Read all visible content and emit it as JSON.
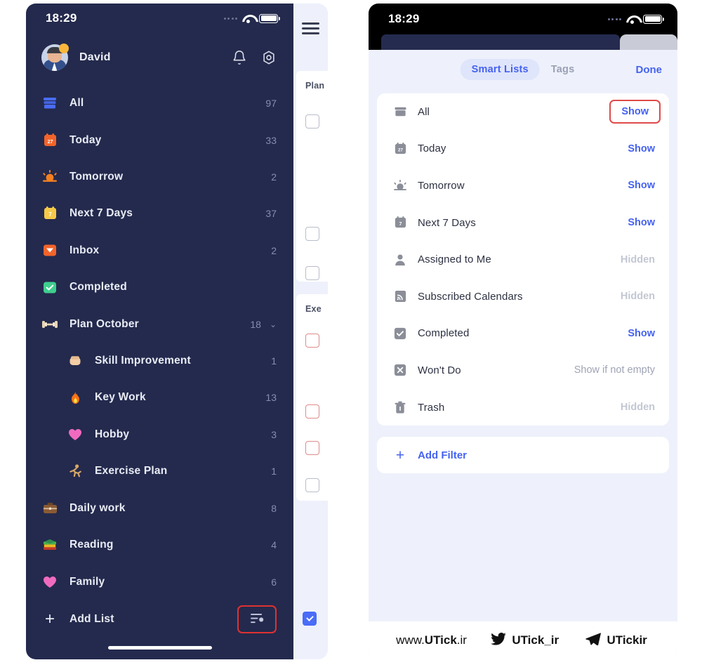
{
  "left_phone": {
    "status_bar": {
      "time": "18:29",
      "wifi_icon": "wifi-icon",
      "battery_icon": "battery-icon"
    },
    "profile": {
      "name": "David",
      "avatar_icon": "avatar",
      "bell_icon": "bell-icon",
      "settings_icon": "gear-icon"
    },
    "nav_items": [
      {
        "label": "All",
        "count": "97",
        "icon": "archive-box-icon",
        "color": "#4a6cf7",
        "indent": false,
        "chevron": ""
      },
      {
        "label": "Today",
        "count": "33",
        "icon": "calendar-27-icon",
        "color": "#f2642a",
        "indent": false,
        "chevron": ""
      },
      {
        "label": "Tomorrow",
        "count": "2",
        "icon": "sunrise-icon",
        "color": "#f58020",
        "indent": false,
        "chevron": ""
      },
      {
        "label": "Next 7 Days",
        "count": "37",
        "icon": "calendar-week-icon",
        "color": "#f7c948",
        "indent": false,
        "chevron": ""
      },
      {
        "label": "Inbox",
        "count": "2",
        "icon": "inbox-icon",
        "color": "#f2642a",
        "indent": false,
        "chevron": ""
      },
      {
        "label": "Completed",
        "count": "",
        "icon": "check-square-icon",
        "color": "#3ecf8e",
        "indent": false,
        "chevron": ""
      },
      {
        "label": "Plan October",
        "count": "18",
        "icon": "dumbbell-emoji",
        "color": "#e8d5b5",
        "indent": false,
        "chevron": "⌄"
      },
      {
        "label": "Skill Improvement",
        "count": "1",
        "icon": "fist-emoji",
        "color": "#f3cda6",
        "indent": true,
        "chevron": ""
      },
      {
        "label": "Key Work",
        "count": "13",
        "icon": "fire-emoji",
        "color": "#f97316",
        "indent": true,
        "chevron": ""
      },
      {
        "label": "Hobby",
        "count": "3",
        "icon": "pink-heart-emoji",
        "color": "#f06bc0",
        "indent": true,
        "chevron": ""
      },
      {
        "label": "Exercise Plan",
        "count": "1",
        "icon": "running-emoji",
        "color": "#d8a86a",
        "indent": true,
        "chevron": ""
      },
      {
        "label": "Daily work",
        "count": "8",
        "icon": "briefcase-emoji",
        "color": "#8a5a34",
        "indent": false,
        "chevron": ""
      },
      {
        "label": "Reading",
        "count": "4",
        "icon": "books-emoji",
        "color": "#4cae4c",
        "indent": false,
        "chevron": ""
      },
      {
        "label": "Family",
        "count": "6",
        "icon": "pink-heart-emoji",
        "color": "#f06bc0",
        "indent": false,
        "chevron": ""
      }
    ],
    "add_list": {
      "label": "Add List",
      "plus_icon": "plus-icon",
      "sort_icon": "sort-settings-icon",
      "sort_highlighted": true
    },
    "peek_panel": {
      "menu_icon": "hamburger-menu-icon",
      "section_1": "Plan",
      "section_2": "Exe"
    }
  },
  "right_phone": {
    "status_bar": {
      "time": "18:29",
      "wifi_icon": "wifi-icon",
      "battery_icon": "battery-icon"
    },
    "tabs": {
      "smart_lists": "Smart Lists",
      "tags": "Tags",
      "done": "Done",
      "active": "Smart Lists"
    },
    "smart_lists": [
      {
        "label": "All",
        "value": "Show",
        "state": "show",
        "icon": "archive-box-icon",
        "highlighted": true
      },
      {
        "label": "Today",
        "value": "Show",
        "state": "show",
        "icon": "calendar-27-icon",
        "highlighted": false
      },
      {
        "label": "Tomorrow",
        "value": "Show",
        "state": "show",
        "icon": "sunrise-icon",
        "highlighted": false
      },
      {
        "label": "Next 7 Days",
        "value": "Show",
        "state": "show",
        "icon": "calendar-week-icon",
        "highlighted": false
      },
      {
        "label": "Assigned to Me",
        "value": "Hidden",
        "state": "hidden",
        "icon": "person-icon",
        "highlighted": false
      },
      {
        "label": "Subscribed Calendars",
        "value": "Hidden",
        "state": "hidden",
        "icon": "calendar-rss-icon",
        "highlighted": false
      },
      {
        "label": "Completed",
        "value": "Show",
        "state": "show",
        "icon": "check-square-icon",
        "highlighted": false
      },
      {
        "label": "Won't Do",
        "value": "Show if not empty",
        "state": "cond",
        "icon": "x-square-icon",
        "highlighted": false
      },
      {
        "label": "Trash",
        "value": "Hidden",
        "state": "hidden",
        "icon": "trash-icon",
        "highlighted": false
      }
    ],
    "add_filter": {
      "label": "Add Filter",
      "plus_icon": "plus-icon"
    },
    "watermark": [
      {
        "icon": "none",
        "light": "www.",
        "bold": "UTick",
        "tail": ".ir"
      },
      {
        "icon": "twitter-icon",
        "light": "",
        "bold": "UTick_ir",
        "tail": ""
      },
      {
        "icon": "telegram-icon",
        "light": "",
        "bold": "UTickir",
        "tail": ""
      }
    ]
  },
  "colors": {
    "sidebar_bg": "#242a4d",
    "accent_blue": "#4562f0",
    "highlight_red": "#e04a4a",
    "sheet_bg": "#eef1fb"
  }
}
